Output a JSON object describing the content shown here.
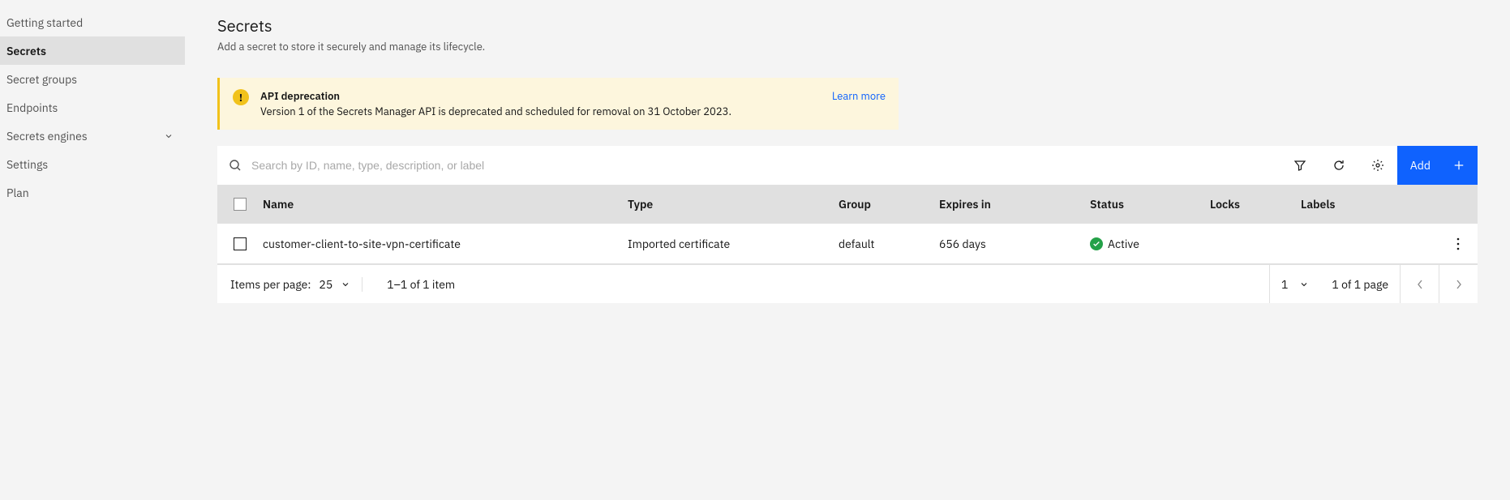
{
  "sidebar": {
    "items": [
      {
        "label": "Getting started"
      },
      {
        "label": "Secrets"
      },
      {
        "label": "Secret groups"
      },
      {
        "label": "Endpoints"
      },
      {
        "label": "Secrets engines"
      },
      {
        "label": "Settings"
      },
      {
        "label": "Plan"
      }
    ]
  },
  "header": {
    "title": "Secrets",
    "subtitle": "Add a secret to store it securely and manage its lifecycle."
  },
  "notification": {
    "title": "API deprecation",
    "body": "Version 1 of the Secrets Manager API is deprecated and scheduled for removal on 31 October 2023.",
    "link": "Learn more"
  },
  "search": {
    "placeholder": "Search by ID, name, type, description, or label"
  },
  "toolbar": {
    "add_label": "Add"
  },
  "columns": {
    "name": "Name",
    "type": "Type",
    "group": "Group",
    "expires": "Expires in",
    "status": "Status",
    "locks": "Locks",
    "labels": "Labels"
  },
  "rows": [
    {
      "name": "customer-client-to-site-vpn-certificate",
      "type": "Imported certificate",
      "group": "default",
      "expires": "656 days",
      "status": "Active"
    }
  ],
  "pagination": {
    "items_per_page_label": "Items per page:",
    "items_per_page_value": "25",
    "range": "1–1 of 1 item",
    "page_value": "1",
    "page_text": "1 of 1 page"
  }
}
